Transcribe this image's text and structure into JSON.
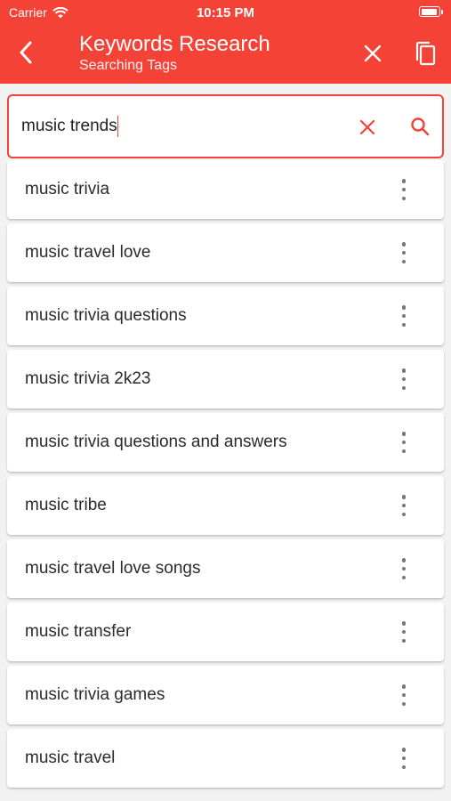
{
  "status_bar": {
    "carrier": "Carrier",
    "time": "10:15 PM",
    "battery_level": 0.95
  },
  "toolbar": {
    "title": "Keywords Research",
    "subtitle": "Searching Tags",
    "back_icon": "chevron-left-icon",
    "close_icon": "close-icon",
    "copy_icon": "copy-icon"
  },
  "search": {
    "value": "music trends",
    "clear_icon": "close-icon",
    "search_icon": "search-icon"
  },
  "colors": {
    "primary": "#f44336",
    "text": "#2b2b2b",
    "menu_dots": "#777777"
  },
  "results": [
    "music trivia",
    "music travel love",
    "music trivia questions",
    "music trivia 2k23",
    "music trivia questions and answers",
    "music tribe",
    "music travel love songs",
    "music transfer",
    "music trivia games",
    "music travel"
  ]
}
